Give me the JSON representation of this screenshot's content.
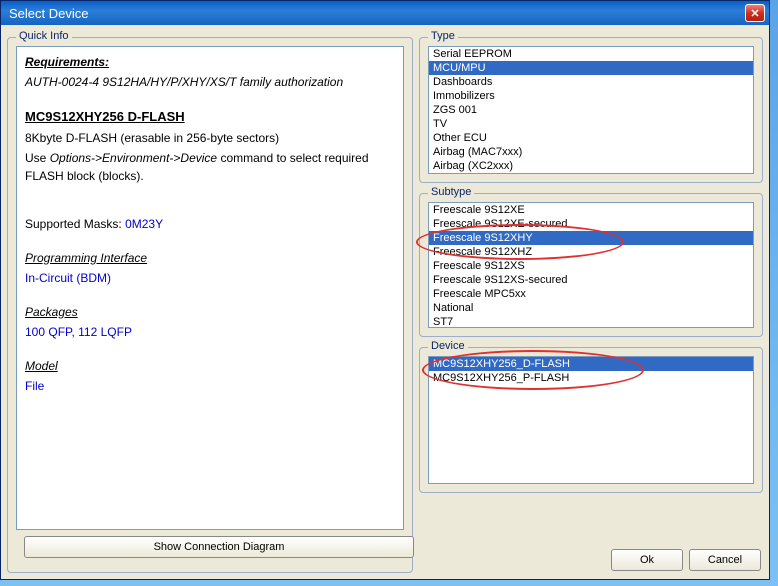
{
  "window": {
    "title": "Select Device"
  },
  "quickinfo": {
    "title": "Quick Info",
    "req_label": "Requirements:",
    "req_text": "AUTH-0024-4  9S12HA/HY/P/XHY/XS/T family authorization",
    "device_name": "MC9S12XHY256 D-FLASH",
    "desc1": "8Kbyte D-FLASH (erasable in 256-byte sectors)",
    "desc2a": "Use ",
    "desc2b": "Options->Environment->Device",
    "desc2c": " command to select required FLASH block (blocks).",
    "masks_label": "Supported Masks: ",
    "masks_value": "0M23Y",
    "prog_label": "Programming Interface",
    "prog_value": "In-Circuit (BDM)",
    "pkg_label": "Packages",
    "pkg_value": "100 QFP, 112 LQFP",
    "model_label": "Model",
    "model_value": "File"
  },
  "type": {
    "title": "Type",
    "items": [
      "Serial EEPROM",
      "MCU/MPU",
      "Dashboards",
      "Immobilizers",
      "ZGS 001",
      "TV",
      "Other ECU",
      "Airbag (MAC7xxx)",
      "Airbag (XC2xxx)"
    ],
    "selected": 1
  },
  "subtype": {
    "title": "Subtype",
    "items": [
      "Freescale 9S12XE",
      "Freescale 9S12XE-secured",
      "Freescale 9S12XHY",
      "Freescale 9S12XHZ",
      "Freescale 9S12XS",
      "Freescale 9S12XS-secured",
      "Freescale MPC5xx",
      "National",
      "ST7"
    ],
    "selected": 2
  },
  "device": {
    "title": "Device",
    "items": [
      "MC9S12XHY256_D-FLASH",
      "MC9S12XHY256_P-FLASH"
    ],
    "selected": 0
  },
  "buttons": {
    "show_diagram": "Show Connection Diagram",
    "ok": "Ok",
    "cancel": "Cancel"
  }
}
